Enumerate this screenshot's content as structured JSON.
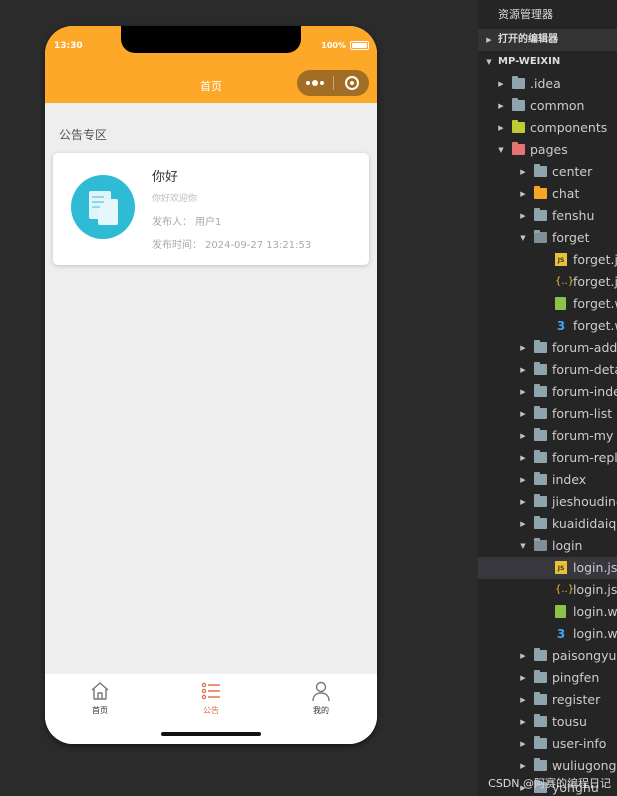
{
  "simulator": {
    "status_time": "13:30",
    "battery": "100%",
    "nav_title": "首页",
    "section_title": "公告专区",
    "card": {
      "icon": "document-icon",
      "title": "你好",
      "subtitle": "你好欢迎你",
      "publisher_label": "发布人：",
      "publisher": "用户1",
      "time_label": "发布时间：",
      "time": "2024-09-27 13:21:53"
    },
    "tabs": [
      {
        "label": "首页",
        "icon": "home-icon",
        "active": false
      },
      {
        "label": "公告",
        "icon": "list-icon",
        "active": true
      },
      {
        "label": "我的",
        "icon": "user-icon",
        "active": false
      }
    ]
  },
  "explorer": {
    "header": "资源管理器",
    "open_editors": "打开的编辑器",
    "project": "MP-WEIXIN",
    "items": [
      {
        "label": ".idea",
        "icon": "folder",
        "depth": 1,
        "arrow": "closed"
      },
      {
        "label": "common",
        "icon": "folder",
        "depth": 1,
        "arrow": "closed"
      },
      {
        "label": "components",
        "icon": "folder-components",
        "depth": 1,
        "arrow": "closed"
      },
      {
        "label": "pages",
        "icon": "folder-pages",
        "depth": 1,
        "arrow": "open"
      },
      {
        "label": "center",
        "icon": "folder",
        "depth": 2,
        "arrow": "closed"
      },
      {
        "label": "chat",
        "icon": "folder-chat",
        "depth": 2,
        "arrow": "closed"
      },
      {
        "label": "fenshu",
        "icon": "folder",
        "depth": 2,
        "arrow": "closed"
      },
      {
        "label": "forget",
        "icon": "folder-open",
        "depth": 2,
        "arrow": "open"
      },
      {
        "label": "forget.js",
        "icon": "js",
        "depth": 3,
        "arrow": "none"
      },
      {
        "label": "forget.json",
        "icon": "json",
        "depth": 3,
        "arrow": "none"
      },
      {
        "label": "forget.wxml",
        "icon": "wxml",
        "depth": 3,
        "arrow": "none"
      },
      {
        "label": "forget.wxss",
        "icon": "wxss",
        "depth": 3,
        "arrow": "none"
      },
      {
        "label": "forum-add-o",
        "icon": "folder",
        "depth": 2,
        "arrow": "closed"
      },
      {
        "label": "forum-detail",
        "icon": "folder",
        "depth": 2,
        "arrow": "closed"
      },
      {
        "label": "forum-index",
        "icon": "folder",
        "depth": 2,
        "arrow": "closed"
      },
      {
        "label": "forum-list",
        "icon": "folder",
        "depth": 2,
        "arrow": "closed"
      },
      {
        "label": "forum-my",
        "icon": "folder",
        "depth": 2,
        "arrow": "closed"
      },
      {
        "label": "forum-reply",
        "icon": "folder",
        "depth": 2,
        "arrow": "closed"
      },
      {
        "label": "index",
        "icon": "folder",
        "depth": 2,
        "arrow": "closed"
      },
      {
        "label": "jieshoudingd",
        "icon": "folder",
        "depth": 2,
        "arrow": "closed"
      },
      {
        "label": "kuaididaiqu",
        "icon": "folder",
        "depth": 2,
        "arrow": "closed"
      },
      {
        "label": "login",
        "icon": "folder-open",
        "depth": 2,
        "arrow": "open"
      },
      {
        "label": "login.js",
        "icon": "js",
        "depth": 3,
        "arrow": "none",
        "selected": true
      },
      {
        "label": "login.json",
        "icon": "json",
        "depth": 3,
        "arrow": "none"
      },
      {
        "label": "login.wxml",
        "icon": "wxml",
        "depth": 3,
        "arrow": "none"
      },
      {
        "label": "login.wxss",
        "icon": "wxss",
        "depth": 3,
        "arrow": "none"
      },
      {
        "label": "paisongyuan",
        "icon": "folder",
        "depth": 2,
        "arrow": "closed"
      },
      {
        "label": "pingfen",
        "icon": "folder",
        "depth": 2,
        "arrow": "closed"
      },
      {
        "label": "register",
        "icon": "folder",
        "depth": 2,
        "arrow": "closed"
      },
      {
        "label": "tousu",
        "icon": "folder",
        "depth": 2,
        "arrow": "closed"
      },
      {
        "label": "user-info",
        "icon": "folder",
        "depth": 2,
        "arrow": "closed"
      },
      {
        "label": "wuliugongsi",
        "icon": "folder",
        "depth": 2,
        "arrow": "closed"
      },
      {
        "label": "yonghu",
        "icon": "folder",
        "depth": 2,
        "arrow": "closed"
      }
    ],
    "watermark": "CSDN @阿赛的编程日记"
  },
  "colors": {
    "nav_bar": "#fda829",
    "active_tab": "#e06a45",
    "card_icon": "#2fbad6",
    "explorer_bg": "#252526",
    "page_bg": "#2b2b2b"
  }
}
